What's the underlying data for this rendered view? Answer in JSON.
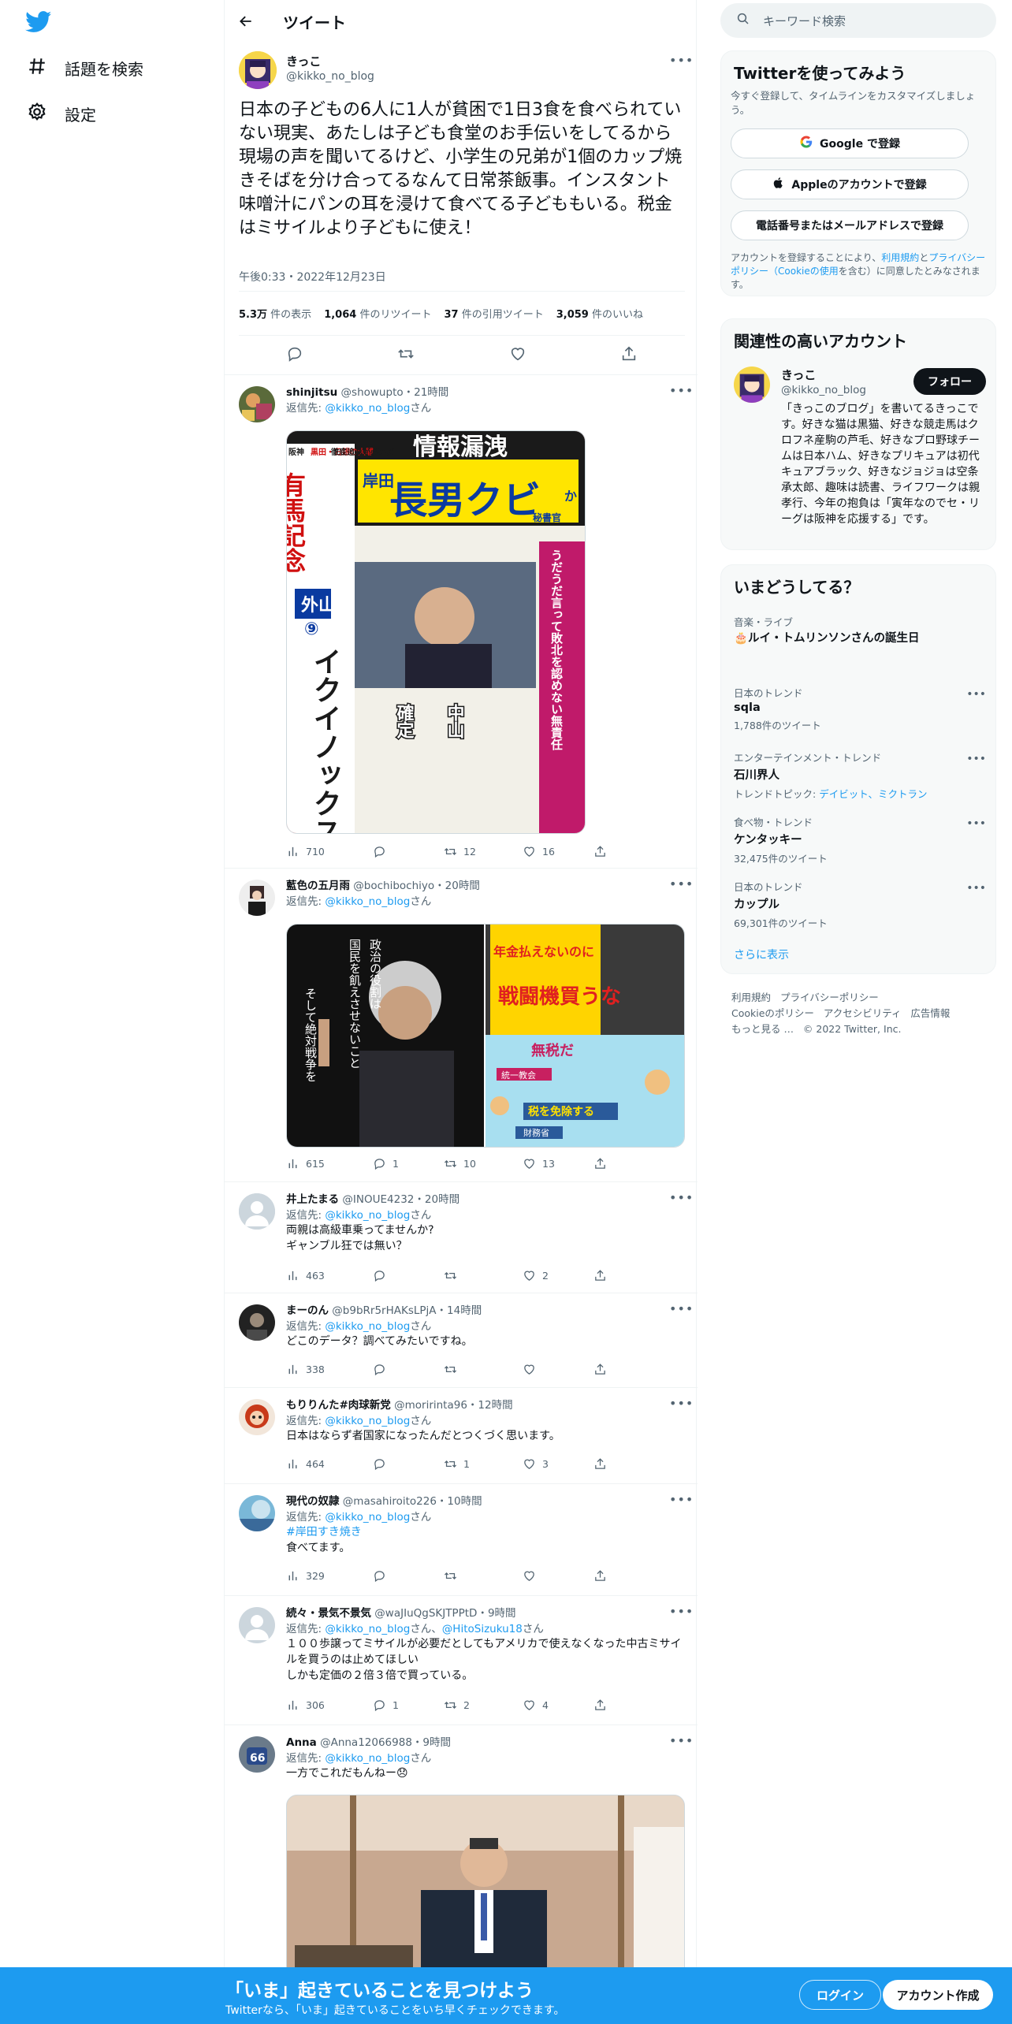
{
  "nav": {
    "logo": "twitter-bird-icon",
    "items": [
      {
        "icon": "hashtag-icon",
        "label": "話題を検索"
      },
      {
        "icon": "gear-icon",
        "label": "設定"
      }
    ]
  },
  "header": {
    "title": "ツイート"
  },
  "focal": {
    "name": "きっこ",
    "handle": "@kikko_no_blog",
    "text": "日本の子どもの6人に1人が貧困で1日3食を食べられていない現実、あたしは子ども食堂のお手伝いをしてるから現場の声を聞いてるけど、小学生の兄弟が1個のカップ焼きそばを分け合ってるなんて日常茶飯事。インスタント味噌汁にパンの耳を浸けて食べてる子どももいる。税金はミサイルより子どもに使え！",
    "time": "午後0:33・2022年12月23日",
    "stats": [
      {
        "num": "5.3万",
        "label": "件の表示"
      },
      {
        "num": "1,064",
        "label": "件のリツイート"
      },
      {
        "num": "37",
        "label": "件の引用ツイート"
      },
      {
        "num": "3,059",
        "label": "件のいいね"
      }
    ]
  },
  "reply_to_prefix": "返信先: ",
  "reply_to_suffix": "さん",
  "reply_to_handle": "@kikko_no_blog",
  "replies": [
    {
      "name": "shinjitsu",
      "handle": "@showupto",
      "time": "・21時間",
      "text": "",
      "views": "710",
      "replies": "",
      "retweets": "12",
      "likes": "16",
      "image_texts": [
        "情報漏洩",
        "岸田",
        "長男クビ",
        "か",
        "秘書官",
        "有馬記念",
        "外山",
        "⑨",
        "イクイノックス",
        "中山",
        "確定",
        "阪神",
        "黒田・日銀の大罪",
        "徹底追及が必要だ",
        "うだうだ言って敗北を認めない無責任"
      ]
    },
    {
      "name": "藍色の五月雨",
      "handle": "@bochibochiyo",
      "time": "・20時間",
      "text": "",
      "views": "615",
      "replies": "1",
      "retweets": "10",
      "likes": "13",
      "image_texts": [
        "政治の役割は",
        "国民を飢えさせないこと",
        "そして絶対戦争を",
        "年金払えないのに",
        "戦闘機買うな",
        "無税だ",
        "統一教会",
        "税を免除する",
        "財務省"
      ]
    },
    {
      "name": "井上たまる",
      "handle": "@INOUE4232",
      "time": "・20時間",
      "text": "両親は高級車乗ってませんか?\nギャンブル狂では無い？",
      "views": "463",
      "replies": "",
      "retweets": "",
      "likes": "2"
    },
    {
      "name": "まーのん",
      "handle": "@b9bRr5rHAKsLPjA",
      "time": "・14時間",
      "text": "どこのデータ？調べてみたいですね。",
      "views": "338",
      "replies": "",
      "retweets": "",
      "likes": ""
    },
    {
      "name": "もりりんた#肉球新党",
      "handle": "@moririnta96",
      "time": "・12時間",
      "text": "日本はならず者国家になったんだとつくづく思います。",
      "views": "464",
      "replies": "",
      "retweets": "1",
      "likes": "3"
    },
    {
      "name": "現代の奴隷",
      "handle": "@masahiroito226",
      "time": "・10時間",
      "hashtag": "#岸田すき焼き",
      "text": "食べてます。",
      "views": "329",
      "replies": "",
      "retweets": "",
      "likes": ""
    },
    {
      "name": "続々・景気不景気",
      "handle": "@waJIuQgSKJTPPtD",
      "time": "・9時間",
      "second_handle": "@HitoSizuku18",
      "text": "１００歩譲ってミサイルが必要だとしてもアメリカで使えなくなった中古ミサイルを買うのは止めてほしい\nしかも定価の２倍３倍で買っている。",
      "views": "306",
      "replies": "1",
      "retweets": "2",
      "likes": "4"
    },
    {
      "name": "Anna",
      "handle": "@Anna12066988",
      "time": "・9時間",
      "text": "一方でこれだもんねー😞",
      "views": "",
      "replies": "",
      "retweets": "",
      "likes": ""
    }
  ],
  "search": {
    "placeholder": "キーワード検索"
  },
  "signup_card": {
    "title": "Twitterを使ってみよう",
    "desc": "今すぐ登録して、タイムラインをカスタマイズしましょう。",
    "google_btn": "Google で登録",
    "apple_btn": "Appleのアカウントで登録",
    "phone_btn": "電話番号またはメールアドレスで登録",
    "legal_1": "アカウントを登録することにより、",
    "legal_terms": "利用規約",
    "legal_and": "と",
    "legal_privacy": "プライバシーポリシー",
    "legal_cookie": "（Cookieの使用",
    "legal_2": "を含む）に同意したとみなされます。"
  },
  "related": {
    "title": "関連性の高いアカウント",
    "name": "きっこ",
    "handle": "@kikko_no_blog",
    "follow": "フォロー",
    "bio": "「きっこのブログ」を書いてるきっこです。好きな猫は黒猫、好きな競走馬はクロフネ産駒の芦毛、好きなプロ野球チームは日本ハム、好きなプリキュアは初代キュアブラック、好きなジョジョは空条承太郎、趣味は読書、ライフワークは親孝行、今年の抱負は「寅年なのでセ・リーグは阪神を応援する」です。"
  },
  "trends": {
    "title": "いまどうしてる？",
    "items": [
      {
        "cat": "音楽・ライブ",
        "title": "🎂ルイ・トムリンソンさんの誕生日",
        "count": ""
      },
      {
        "cat": "日本のトレンド",
        "title": "sqla",
        "count": "1,788件のツイート"
      },
      {
        "cat": "エンターテインメント・トレンド",
        "title": "石川界人",
        "count": "トレンドトピック: ",
        "links": "デイビット、ミクトラン"
      },
      {
        "cat": "食べ物・トレンド",
        "title": "ケンタッキー",
        "count": "32,475件のツイート"
      },
      {
        "cat": "日本のトレンド",
        "title": "カップル",
        "count": "69,301件のツイート"
      }
    ],
    "show_more": "さらに表示"
  },
  "footer": {
    "items": [
      "利用規約",
      "プライバシーポリシー",
      "Cookieのポリシー",
      "アクセシビリティ",
      "広告情報",
      "もっと見る …",
      "© 2022 Twitter, Inc."
    ]
  },
  "bottom": {
    "title": "「いま」起きていることを見つけよう",
    "subtitle": "Twitterなら、「いま」起きていることをいち早くチェックできます。",
    "login": "ログイン",
    "signup": "アカウント作成"
  },
  "colors": {
    "accent": "#1d9bf0",
    "text": "#0f1419",
    "muted": "#536471",
    "border": "#eff3f4"
  }
}
